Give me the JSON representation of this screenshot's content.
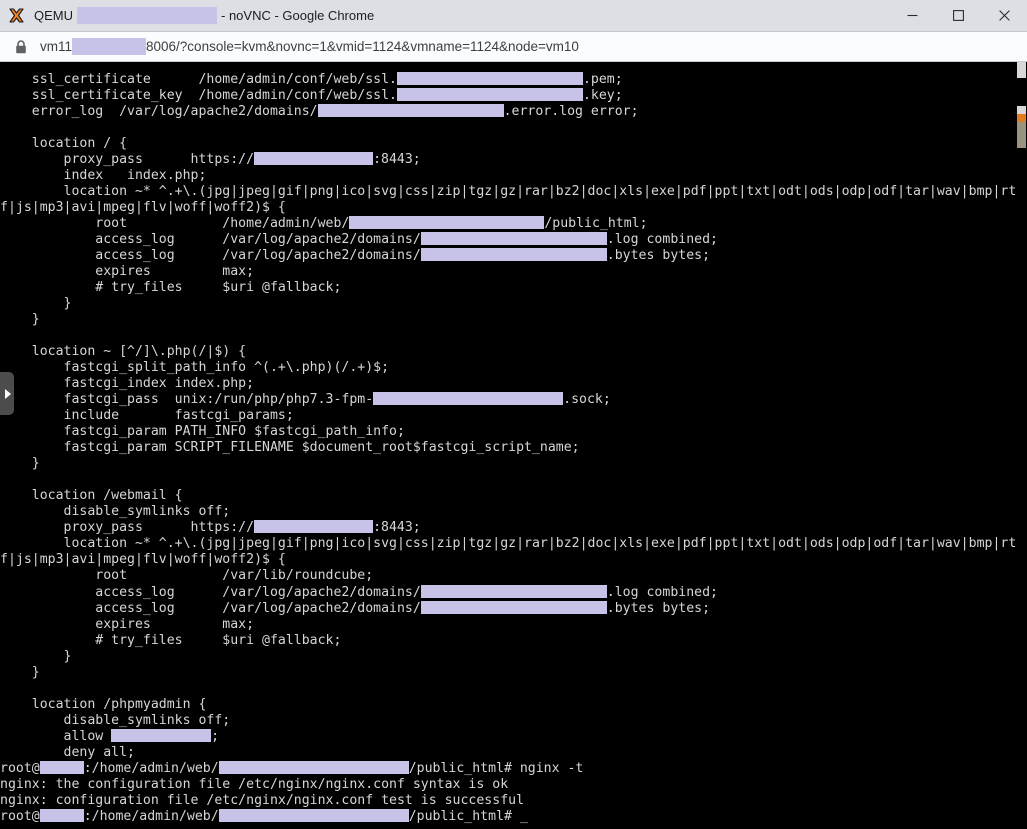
{
  "window": {
    "favicon": "qemu-logo-icon",
    "title_prefix": "QEMU",
    "title_redacted_width": 140,
    "title_suffix": "- noVNC - Google Chrome",
    "minimize_label": "Minimize",
    "maximize_label": "Maximize",
    "close_label": "Close"
  },
  "urlbar": {
    "lock_icon": "lock-icon",
    "url_prefix": "vm11",
    "url_redacted_width": 74,
    "url_suffix": "8006/?console=kvm&novnc=1&vmid=1124&vmname=1124&node=vm10"
  },
  "vnc": {
    "handle_icon": "chevron-right-icon",
    "redaction_color": "#c7c3e8",
    "terminal_bg": "#000000",
    "terminal_fg": "#d6d6d6",
    "lines": [
      [
        {
          "t": "    ssl_certificate      /home/admin/conf/web/ssl."
        },
        {
          "r": 186
        },
        {
          "t": ".pem;"
        }
      ],
      [
        {
          "t": "    ssl_certificate_key  /home/admin/conf/web/ssl."
        },
        {
          "r": 186
        },
        {
          "t": ".key;"
        }
      ],
      [
        {
          "t": "    error_log  /var/log/apache2/domains/"
        },
        {
          "r": 186
        },
        {
          "t": ".error.log error;"
        }
      ],
      [
        {
          "t": ""
        }
      ],
      [
        {
          "t": "    location / {"
        }
      ],
      [
        {
          "t": "        proxy_pass      https://"
        },
        {
          "r": 119
        },
        {
          "t": ":8443;"
        }
      ],
      [
        {
          "t": "        index   index.php;"
        }
      ],
      [
        {
          "t": "        location ~* ^.+\\.(jpg|jpeg|gif|png|ico|svg|css|zip|tgz|gz|rar|bz2|doc|xls|exe|pdf|ppt|txt|odt|ods|odp|odf|tar|wav|bmp|rt"
        }
      ],
      [
        {
          "t": "f|js|mp3|avi|mpeg|flv|woff|woff2)$ {"
        }
      ],
      [
        {
          "t": "            root            /home/admin/web/"
        },
        {
          "r": 195
        },
        {
          "t": "/public_html;"
        }
      ],
      [
        {
          "t": "            access_log      /var/log/apache2/domains/"
        },
        {
          "r": 186
        },
        {
          "t": ".log combined;"
        }
      ],
      [
        {
          "t": "            access_log      /var/log/apache2/domains/"
        },
        {
          "r": 186
        },
        {
          "t": ".bytes bytes;"
        }
      ],
      [
        {
          "t": "            expires         max;"
        }
      ],
      [
        {
          "t": "            # try_files     $uri @fallback;"
        }
      ],
      [
        {
          "t": "        }"
        }
      ],
      [
        {
          "t": "    }"
        }
      ],
      [
        {
          "t": ""
        }
      ],
      [
        {
          "t": "    location ~ [^/]\\.php(/|$) {"
        }
      ],
      [
        {
          "t": "        fastcgi_split_path_info ^(.+\\.php)(/.+)$;"
        }
      ],
      [
        {
          "t": "        fastcgi_index index.php;"
        }
      ],
      [
        {
          "t": "        fastcgi_pass  unix:/run/php/php7.3-fpm-"
        },
        {
          "r": 190
        },
        {
          "t": ".sock;"
        }
      ],
      [
        {
          "t": "        include       fastcgi_params;"
        }
      ],
      [
        {
          "t": "        fastcgi_param PATH_INFO $fastcgi_path_info;"
        }
      ],
      [
        {
          "t": "        fastcgi_param SCRIPT_FILENAME $document_root$fastcgi_script_name;"
        }
      ],
      [
        {
          "t": "    }"
        }
      ],
      [
        {
          "t": ""
        }
      ],
      [
        {
          "t": "    location /webmail {"
        }
      ],
      [
        {
          "t": "        disable_symlinks off;"
        }
      ],
      [
        {
          "t": "        proxy_pass      https://"
        },
        {
          "r": 119
        },
        {
          "t": ":8443;"
        }
      ],
      [
        {
          "t": "        location ~* ^.+\\.(jpg|jpeg|gif|png|ico|svg|css|zip|tgz|gz|rar|bz2|doc|xls|exe|pdf|ppt|txt|odt|ods|odp|odf|tar|wav|bmp|rt"
        }
      ],
      [
        {
          "t": "f|js|mp3|avi|mpeg|flv|woff|woff2)$ {"
        }
      ],
      [
        {
          "t": "            root            /var/lib/roundcube;"
        }
      ],
      [
        {
          "t": "            access_log      /var/log/apache2/domains/"
        },
        {
          "r": 186
        },
        {
          "t": ".log combined;"
        }
      ],
      [
        {
          "t": "            access_log      /var/log/apache2/domains/"
        },
        {
          "r": 186
        },
        {
          "t": ".bytes bytes;"
        }
      ],
      [
        {
          "t": "            expires         max;"
        }
      ],
      [
        {
          "t": "            # try_files     $uri @fallback;"
        }
      ],
      [
        {
          "t": "        }"
        }
      ],
      [
        {
          "t": "    }"
        }
      ],
      [
        {
          "t": ""
        }
      ],
      [
        {
          "t": "    location /phpmyadmin {"
        }
      ],
      [
        {
          "t": "        disable_symlinks off;"
        }
      ],
      [
        {
          "t": "        allow "
        },
        {
          "r": 100
        },
        {
          "t": ";"
        }
      ],
      [
        {
          "t": "        deny all;"
        }
      ],
      [
        {
          "t": "root@"
        },
        {
          "r": 44
        },
        {
          "t": ":/home/admin/web/"
        },
        {
          "r": 190
        },
        {
          "t": "/public_html# nginx -t"
        }
      ],
      [
        {
          "t": "nginx: the configuration file /etc/nginx/nginx.conf syntax is ok"
        }
      ],
      [
        {
          "t": "nginx: configuration file /etc/nginx/nginx.conf test is successful"
        }
      ],
      [
        {
          "t": "root@"
        },
        {
          "r": 44
        },
        {
          "t": ":/home/admin/web/"
        },
        {
          "r": 190
        },
        {
          "t": "/public_html# _"
        }
      ]
    ]
  }
}
